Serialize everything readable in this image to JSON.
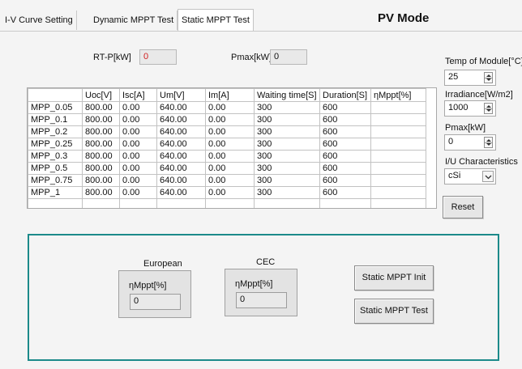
{
  "tabs": [
    {
      "label": "I-V Curve Setting",
      "active": false
    },
    {
      "label": "Dynamic MPPT Test",
      "active": false
    },
    {
      "label": "Static MPPT Test",
      "active": true
    }
  ],
  "mode_title": "PV Mode",
  "readouts": {
    "rtp_label": "RT-P[kW]",
    "rtp_value": "0",
    "pmax_label": "Pmax[kW]",
    "pmax_value": "0"
  },
  "table": {
    "columns": [
      "",
      "Uoc[V]",
      "Isc[A]",
      "Um[V]",
      "Im[A]",
      "Waiting time[S]",
      "Duration[S]",
      "ηMppt[%]"
    ],
    "rows": [
      [
        "MPP_0.05",
        "800.00",
        "0.00",
        "640.00",
        "0.00",
        "300",
        "600",
        ""
      ],
      [
        "MPP_0.1",
        "800.00",
        "0.00",
        "640.00",
        "0.00",
        "300",
        "600",
        ""
      ],
      [
        "MPP_0.2",
        "800.00",
        "0.00",
        "640.00",
        "0.00",
        "300",
        "600",
        ""
      ],
      [
        "MPP_0.25",
        "800.00",
        "0.00",
        "640.00",
        "0.00",
        "300",
        "600",
        ""
      ],
      [
        "MPP_0.3",
        "800.00",
        "0.00",
        "640.00",
        "0.00",
        "300",
        "600",
        ""
      ],
      [
        "MPP_0.5",
        "800.00",
        "0.00",
        "640.00",
        "0.00",
        "300",
        "600",
        ""
      ],
      [
        "MPP_0.75",
        "800.00",
        "0.00",
        "640.00",
        "0.00",
        "300",
        "600",
        ""
      ],
      [
        "MPP_1",
        "800.00",
        "0.00",
        "640.00",
        "0.00",
        "300",
        "600",
        ""
      ]
    ]
  },
  "settings": {
    "temp_label": "Temp of Module[°C]",
    "temp_value": "25",
    "irradiance_label": "Irradiance[W/m2]",
    "irradiance_value": "1000",
    "pmax_label": "Pmax[kW]",
    "pmax_value": "0",
    "iu_label": "I/U Characteristics",
    "iu_value": "cSi",
    "reset_label": "Reset"
  },
  "results": {
    "european_title": "European",
    "european_label": "ηMppt[%]",
    "european_value": "0",
    "cec_title": "CEC",
    "cec_label": "ηMppt[%]",
    "cec_value": "0",
    "init_button": "Static MPPT Init",
    "test_button": "Static MPPT Test"
  },
  "icons": {
    "spin": "spin-updown-icon",
    "dropdown": "chevron-down-icon"
  },
  "colors": {
    "groupbox_border": "#1c8a8a",
    "alert_value": "#d11f1f"
  }
}
